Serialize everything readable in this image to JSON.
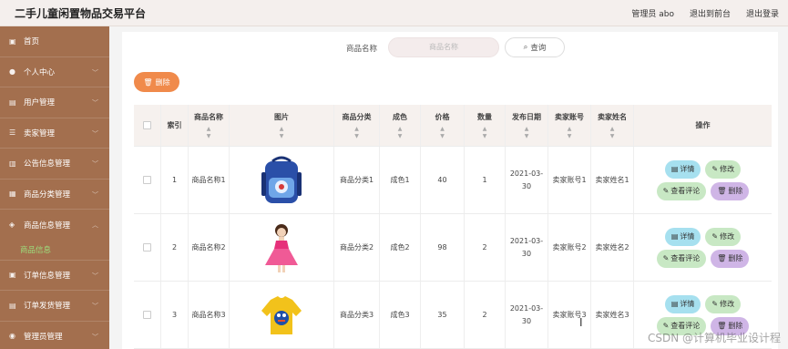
{
  "header": {
    "title": "二手儿童闲置物品交易平台",
    "user": "管理员 abo",
    "back_front": "退出到前台",
    "logout": "退出登录"
  },
  "sidebar": {
    "items": [
      {
        "label": "首页",
        "icon": "home-icon"
      },
      {
        "label": "个人中心",
        "icon": "user-icon"
      },
      {
        "label": "用户管理",
        "icon": "users-icon"
      },
      {
        "label": "卖家管理",
        "icon": "list-icon"
      },
      {
        "label": "公告信息管理",
        "icon": "notice-icon"
      },
      {
        "label": "商品分类管理",
        "icon": "category-icon"
      },
      {
        "label": "商品信息管理",
        "icon": "goods-icon"
      },
      {
        "label": "订单信息管理",
        "icon": "order-icon"
      },
      {
        "label": "订单发货管理",
        "icon": "ship-icon"
      },
      {
        "label": "管理员管理",
        "icon": "admin-icon"
      }
    ],
    "submenu_label": "商品信息"
  },
  "search": {
    "label": "商品名称",
    "placeholder": "商品名称",
    "button": "查询"
  },
  "toolbar": {
    "delete": "删除"
  },
  "table": {
    "headers": [
      "索引",
      "商品名称",
      "图片",
      "商品分类",
      "成色",
      "价格",
      "数量",
      "发布日期",
      "卖家账号",
      "卖家姓名",
      "操作"
    ],
    "rows": [
      {
        "index": "1",
        "name": "商品名称1",
        "image": "backpack",
        "category": "商品分类1",
        "condition": "成色1",
        "price": "40",
        "qty": "1",
        "date": "2021-03-30",
        "seller_account": "卖家账号1",
        "seller_name": "卖家姓名1"
      },
      {
        "index": "2",
        "name": "商品名称2",
        "image": "girl-dress",
        "category": "商品分类2",
        "condition": "成色2",
        "price": "98",
        "qty": "2",
        "date": "2021-03-30",
        "seller_account": "卖家账号2",
        "seller_name": "卖家姓名2"
      },
      {
        "index": "3",
        "name": "商品名称3",
        "image": "sweater",
        "category": "商品分类3",
        "condition": "成色3",
        "price": "35",
        "qty": "2",
        "date": "2021-03-30",
        "seller_account": "卖家账号3",
        "seller_name": "卖家姓名3"
      }
    ],
    "actions": {
      "detail": "详情",
      "edit": "修改",
      "comment": "查看评论",
      "delete": "删除"
    }
  },
  "watermark": "CSDN @计算机毕业设计程",
  "colors": {
    "sidebar": "#a36f4e",
    "delete_btn": "#f08a4b",
    "detail_btn": "#a6e0ef",
    "edit_btn": "#c8e8c4",
    "del_row_btn": "#cfb5e6",
    "submenu_active": "#9ce07d"
  }
}
